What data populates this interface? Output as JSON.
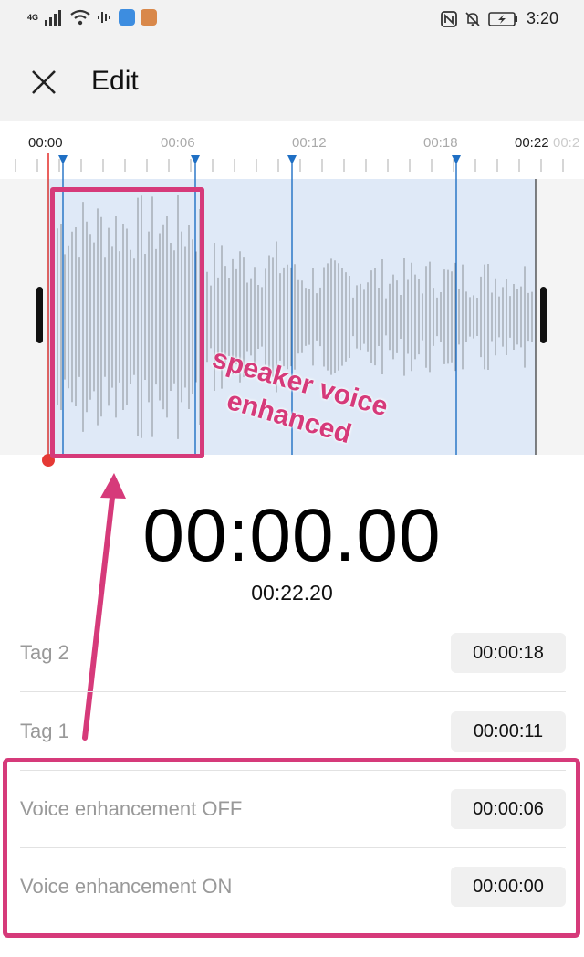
{
  "status_bar": {
    "network": "4G",
    "time": "3:20"
  },
  "toolbar": {
    "title": "Edit"
  },
  "timeline": {
    "labels": [
      "00:00",
      "00:06",
      "00:12",
      "00:18",
      "00:22"
    ],
    "cut_label": "00:2"
  },
  "playback": {
    "current_time": "00:00.00",
    "total_time": "00:22.20"
  },
  "tags": [
    {
      "label": "Tag 2",
      "time": "00:00:18"
    },
    {
      "label": "Tag 1",
      "time": "00:00:11"
    },
    {
      "label": "Voice enhancement OFF",
      "time": "00:00:06"
    },
    {
      "label": "Voice enhancement ON",
      "time": "00:00:00"
    }
  ],
  "annotation": {
    "line1": "speaker voice",
    "line2": "enhanced",
    "color": "#d63a7a"
  },
  "colors": {
    "waveform_selection": "#dfe9f7",
    "marker": "#1f6fc4",
    "playhead": "#e53935"
  }
}
